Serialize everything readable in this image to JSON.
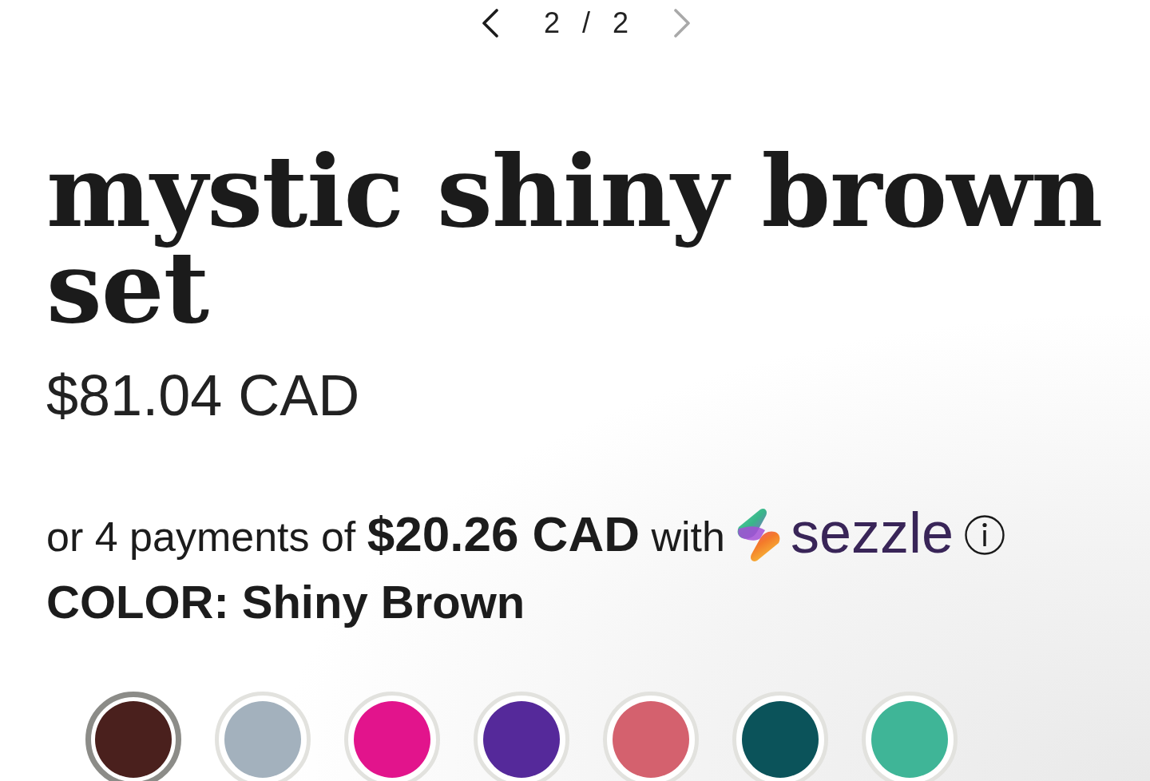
{
  "pager": {
    "previous": {
      "disabled": false
    },
    "position": "2 / 2",
    "next": {
      "disabled": true
    }
  },
  "product": {
    "title": "mystic shiny brown set",
    "price": "$81.04 CAD"
  },
  "installments": {
    "text": "or 4 payments of **$20.26 CAD** with",
    "provider": "sezzle"
  },
  "color_option": {
    "label": "COLOR:",
    "value": "Shiny Brown"
  },
  "swatches": [
    {
      "color": "#4a201d",
      "selected": true
    },
    {
      "color": "#a3b1bd",
      "selected": false
    },
    {
      "color": "#e2148c",
      "selected": false
    },
    {
      "color": "#55299a",
      "selected": false
    },
    {
      "color": "#d4616e",
      "selected": false
    },
    {
      "color": "#0b535a",
      "selected": false
    },
    {
      "color": "#3fb597",
      "selected": false
    }
  ]
}
